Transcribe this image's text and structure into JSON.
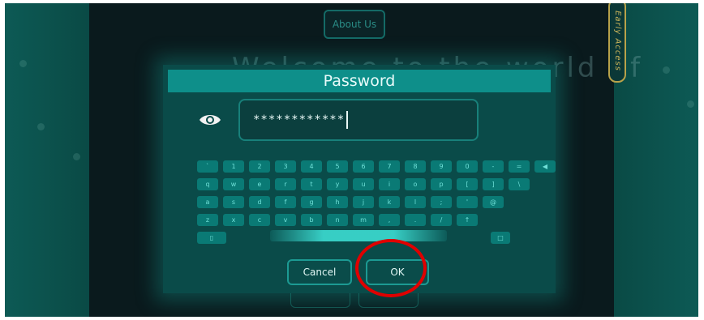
{
  "background": {
    "about_button_label": "About Us",
    "early_access_label": "Early Access",
    "ghost_heading": "Welcome to the world of"
  },
  "dialog": {
    "title": "Password",
    "password_masked": "************",
    "show_password_icon": "eye-icon",
    "keyboard": {
      "row1": [
        "`",
        "1",
        "2",
        "3",
        "4",
        "5",
        "6",
        "7",
        "8",
        "9",
        "0",
        "-",
        "=",
        "◀"
      ],
      "row2": [
        "q",
        "w",
        "e",
        "r",
        "t",
        "y",
        "u",
        "i",
        "o",
        "p",
        "[",
        "]",
        "\\"
      ],
      "row3": [
        "a",
        "s",
        "d",
        "f",
        "g",
        "h",
        "j",
        "k",
        "l",
        ";",
        "'",
        "@"
      ],
      "row4": [
        "z",
        "x",
        "c",
        "v",
        "b",
        "n",
        "m",
        ",",
        ".",
        "/",
        "↑"
      ],
      "left_special_icon": "clipboard-icon",
      "right_special_icon": "square-icon"
    },
    "cancel_label": "Cancel",
    "ok_label": "OK"
  },
  "colors": {
    "dialog_bg": "#0a4b49",
    "title_bar": "#0e8f8a",
    "key_bg": "#0a7a75",
    "highlight_circle": "#e00000",
    "early_access_border": "#b8a24a"
  }
}
